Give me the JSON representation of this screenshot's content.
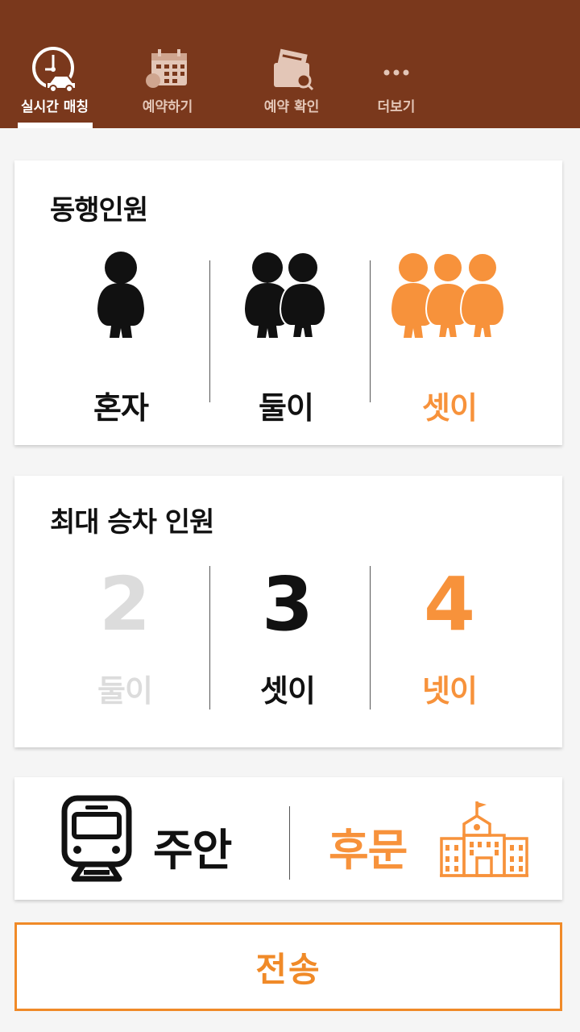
{
  "colors": {
    "header_bg": "#7a381c",
    "accent": "#f7923b",
    "selected_dark": "#111111",
    "disabled": "#dcdcdc"
  },
  "tabs": [
    {
      "label": "실시간 매칭",
      "icon": "clock-car-icon",
      "active": true
    },
    {
      "label": "예약하기",
      "icon": "calendar-icon",
      "active": false
    },
    {
      "label": "예약 확인",
      "icon": "wallet-search-icon",
      "active": false
    },
    {
      "label": "더보기",
      "icon": "more-dots-icon",
      "active": false
    }
  ],
  "companions": {
    "title": "동행인원",
    "options": [
      {
        "label": "혼자",
        "icon": "person-icon"
      },
      {
        "label": "둘이",
        "icon": "two-people-icon"
      },
      {
        "label": "셋이",
        "icon": "three-people-icon"
      }
    ]
  },
  "max_riders": {
    "title": "최대 승차 인원",
    "options": [
      {
        "number": "2",
        "label": "둘이"
      },
      {
        "number": "3",
        "label": "셋이"
      },
      {
        "number": "4",
        "label": "넷이"
      }
    ]
  },
  "route": {
    "from_label": "주안",
    "from_icon": "train-icon",
    "to_label": "후문",
    "to_icon": "school-building-icon"
  },
  "send_button": {
    "label": "전송"
  }
}
